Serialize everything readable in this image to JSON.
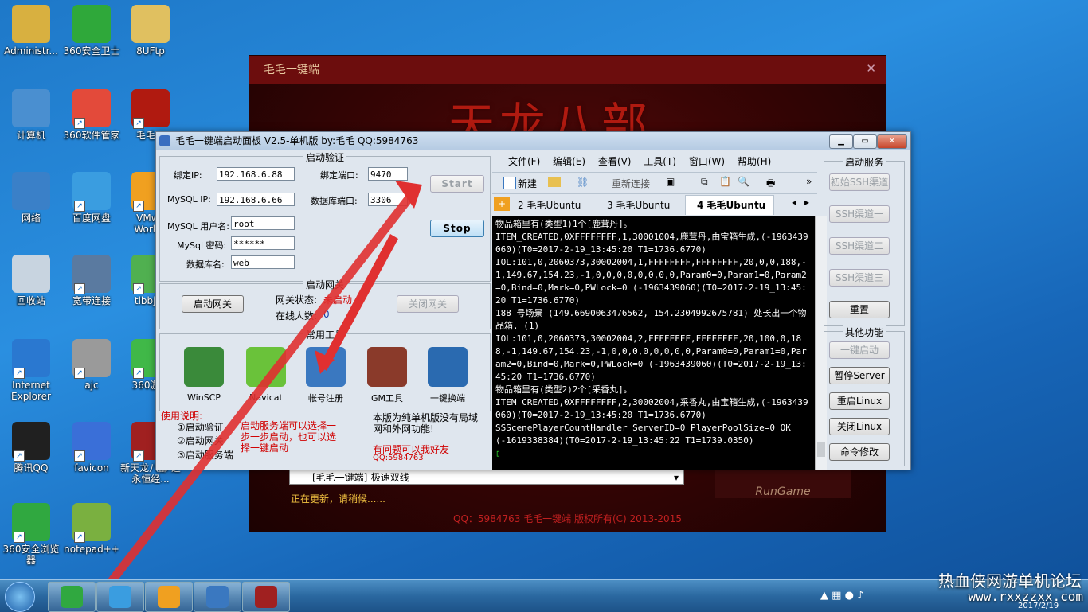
{
  "desktop": {
    "icons": [
      {
        "label": "Administr...",
        "color": "#d8b040"
      },
      {
        "label": "360安全卫士",
        "color": "#2fa83a"
      },
      {
        "label": "8UFtp",
        "color": "#e0c060"
      },
      {
        "label": "计算机",
        "color": "#4a8fd0"
      },
      {
        "label": "360软件管家",
        "color": "#e34a3a"
      },
      {
        "label": "毛毛一",
        "color": "#b01a10"
      },
      {
        "label": "网络",
        "color": "#3a80c8"
      },
      {
        "label": "百度网盘",
        "color": "#3a9de0"
      },
      {
        "label": "VMwa Workst",
        "color": "#f0a020"
      },
      {
        "label": "回收站",
        "color": "#c8d4e0"
      },
      {
        "label": "宽带连接",
        "color": "#5a7aa0"
      },
      {
        "label": "tlbbjd_",
        "color": "#50b050"
      },
      {
        "label": "Internet Explorer",
        "color": "#2a78d0"
      },
      {
        "label": "ajc",
        "color": "#9a9a9a"
      },
      {
        "label": "360游戏",
        "color": "#40b848"
      },
      {
        "label": "腾讯QQ",
        "color": "#202020"
      },
      {
        "label": "favicon",
        "color": "#3a6fd8"
      },
      {
        "label": "新天龙八部 之永恒经...",
        "color": "#a02020"
      },
      {
        "label": "360安全浏览器",
        "color": "#30a840"
      },
      {
        "label": "notepad++",
        "color": "#7ab040"
      }
    ]
  },
  "launcher": {
    "title": "毛毛一键端",
    "close": "✕",
    "minimize": "—",
    "banner": "天龙八部",
    "server_select": "[毛毛一键端]-极速双线",
    "update_text": "正在更新，请稍候......",
    "footer": "QQ：5984763  毛毛一键端  版权所有(C) 2013-2015",
    "run_label": "RunGame"
  },
  "panel": {
    "title": "毛毛一键端启动面板 V2.5-单机版 by:毛毛  QQ:5984763",
    "verify_group": "启动验证",
    "bind_ip_label": "绑定IP:",
    "bind_ip": "192.168.6.88",
    "bind_port_label": "绑定端口:",
    "bind_port": "9470",
    "mysql_ip_label": "MySQL IP:",
    "mysql_ip": "192.168.6.66",
    "db_port_label": "数据库端口:",
    "db_port": "3306",
    "mysql_user_label": "MySQL 用户名:",
    "mysql_user": "root",
    "mysql_pwd_label": "MySql 密码:",
    "mysql_pwd": "******",
    "db_name_label": "数据库名:",
    "db_name": "web",
    "start_btn": "Start",
    "stop_btn": "Stop",
    "gateway_group": "启动网关",
    "start_gateway_btn": "启动网关",
    "gateway_status_label": "网关状态:",
    "gateway_status": "未启动",
    "online_label": "在线人数:",
    "online_count": "0",
    "close_gateway_btn": "关闭网关",
    "tools_group": "常用工具",
    "tools": [
      {
        "label": "WinSCP",
        "color": "#3a8a3a"
      },
      {
        "label": "Navicat",
        "color": "#6ac23a"
      },
      {
        "label": "帐号注册",
        "color": "#3a78c0"
      },
      {
        "label": "GM工具",
        "color": "#8a3a2a"
      },
      {
        "label": "一键换端",
        "color": "#2a6ab0"
      }
    ],
    "usage_title": "使用说明:",
    "usage_steps": [
      "①启动验证",
      "②启动网关",
      "③启动服务端"
    ],
    "note_mid": "启动服务端可以选择一步一步启动，也可以选择一键启动",
    "note_right": "本版为纯单机版没有局域网和外网功能!",
    "contact": "有问题可以我好友",
    "contact_qq": "QQ:5984763"
  },
  "xshell": {
    "menu": [
      "文件(F)",
      "编辑(E)",
      "查看(V)",
      "工具(T)",
      "窗口(W)",
      "帮助(H)"
    ],
    "toolbar_new": "新建",
    "toolbar_reconnect": "重新连接",
    "tabs": [
      "2 毛毛Ubuntu",
      "3 毛毛Ubuntu",
      "4 毛毛Ubuntu"
    ],
    "terminal_lines": [
      "物品箱里有(类型1)1个[鹿茸丹]。",
      "ITEM_CREATED,0XFFFFFFFF,1,30001004,鹿茸丹,由宝箱生成,(-1963439060)(T0=2017-2-19_13:45:20 T1=1736.6770)",
      "IOL:101,0,2060373,30002004,1,FFFFFFFF,FFFFFFFF,20,0,0,188,-1,149.67,154.23,-1,0,0,0,0,0,0,0,0,Param0=0,Param1=0,Param2=0,Bind=0,Mark=0,PWLock=0 (-1963439060)(T0=2017-2-19_13:45:20 T1=1736.6770)",
      "188 号场景 (149.6690063476562, 154.2304992675781) 处长出一个物品箱. (1)",
      "IOL:101,0,2060373,30002004,2,FFFFFFFF,FFFFFFFF,20,100,0,188,-1,149.67,154.23,-1,0,0,0,0,0,0,0,0,Param0=0,Param1=0,Param2=0,Bind=0,Mark=0,PWLock=0 (-1963439060)(T0=2017-2-19_13:45:20 T1=1736.6770)",
      "物品箱里有(类型2)2个[采香丸]。",
      "ITEM_CREATED,0XFFFFFFFF,2,30002004,采香丸,由宝箱生成,(-1963439060)(T0=2017-2-19_13:45:20 T1=1736.6770)",
      "SSScenePlayerCountHandler ServerID=0 PlayerPoolSize=0 OK  (-1619338384)(T0=2017-2-19_13:45:22 T1=1739.0350)"
    ]
  },
  "services": {
    "start_group": "启动服务",
    "buttons": [
      "初始SSH渠道",
      "SSH渠道一",
      "SSH渠道二",
      "SSH渠道三"
    ],
    "reset": "重置",
    "other_group": "其他功能",
    "other_buttons": [
      "一键启动",
      "暂停Server",
      "重启Linux",
      "关闭Linux",
      "命令修改"
    ]
  },
  "taskbar": {
    "items": [
      {
        "name": "start",
        "color": "#3a8ad0"
      },
      {
        "name": "360browser",
        "color": "#30a840"
      },
      {
        "name": "baidu",
        "color": "#3a9de0"
      },
      {
        "name": "vmware",
        "color": "#f0a020"
      },
      {
        "name": "python",
        "color": "#3a78c0"
      },
      {
        "name": "tlbb",
        "color": "#a02020"
      }
    ],
    "watermark": "热血侠网游单机论坛",
    "watermark_url": "www.rxxzzxx.com",
    "date": "2017/2/19"
  }
}
